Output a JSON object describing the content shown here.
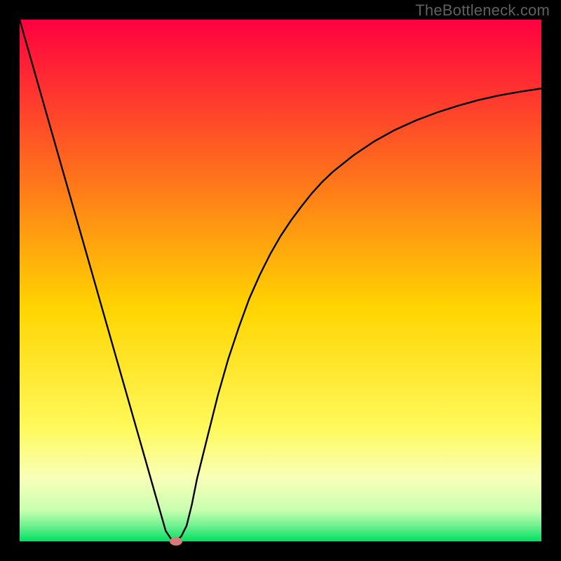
{
  "watermark": "TheBottleneck.com",
  "colors": {
    "bg_black": "#000000",
    "gradient_top": "#ff0040",
    "gradient_mid1": "#ff7c1e",
    "gradient_mid2": "#ffd400",
    "gradient_low": "#ffff70",
    "gradient_pale": "#f0ffb0",
    "gradient_bottom": "#00e060",
    "curve": "#000000",
    "marker": "#d67a7a"
  },
  "chart_data": {
    "type": "line",
    "title": "",
    "xlabel": "",
    "ylabel": "",
    "xlim": [
      0,
      100
    ],
    "ylim": [
      0,
      100
    ],
    "x": [
      0,
      2,
      4,
      6,
      8,
      10,
      12,
      14,
      16,
      18,
      20,
      22,
      24,
      26,
      27,
      28,
      29,
      30,
      31,
      32,
      33,
      34,
      36,
      38,
      40,
      42,
      44,
      46,
      48,
      50,
      52,
      54,
      56,
      58,
      60,
      64,
      68,
      72,
      76,
      80,
      84,
      88,
      92,
      96,
      100
    ],
    "y": [
      100,
      93,
      86,
      79,
      72,
      65,
      58,
      51,
      44,
      37,
      30,
      23,
      16,
      9,
      5.5,
      2,
      0.5,
      0,
      1,
      3,
      7,
      12,
      20,
      28,
      35,
      41,
      46.5,
      51,
      55,
      58.5,
      61.5,
      64.2,
      66.7,
      68.9,
      70.8,
      74.0,
      76.7,
      78.9,
      80.7,
      82.2,
      83.5,
      84.6,
      85.5,
      86.2,
      86.8
    ],
    "annotations": [
      {
        "label": "marker",
        "x": 30,
        "y": 0
      }
    ]
  }
}
